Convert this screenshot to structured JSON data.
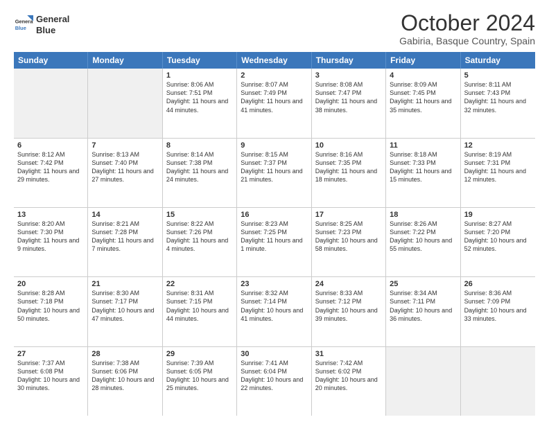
{
  "logo": {
    "line1": "General",
    "line2": "Blue"
  },
  "title": "October 2024",
  "location": "Gabiria, Basque Country, Spain",
  "header_days": [
    "Sunday",
    "Monday",
    "Tuesday",
    "Wednesday",
    "Thursday",
    "Friday",
    "Saturday"
  ],
  "weeks": [
    [
      {
        "day": "",
        "sunrise": "",
        "sunset": "",
        "daylight": "",
        "shaded": true
      },
      {
        "day": "",
        "sunrise": "",
        "sunset": "",
        "daylight": "",
        "shaded": true
      },
      {
        "day": "1",
        "sunrise": "Sunrise: 8:06 AM",
        "sunset": "Sunset: 7:51 PM",
        "daylight": "Daylight: 11 hours and 44 minutes."
      },
      {
        "day": "2",
        "sunrise": "Sunrise: 8:07 AM",
        "sunset": "Sunset: 7:49 PM",
        "daylight": "Daylight: 11 hours and 41 minutes."
      },
      {
        "day": "3",
        "sunrise": "Sunrise: 8:08 AM",
        "sunset": "Sunset: 7:47 PM",
        "daylight": "Daylight: 11 hours and 38 minutes."
      },
      {
        "day": "4",
        "sunrise": "Sunrise: 8:09 AM",
        "sunset": "Sunset: 7:45 PM",
        "daylight": "Daylight: 11 hours and 35 minutes."
      },
      {
        "day": "5",
        "sunrise": "Sunrise: 8:11 AM",
        "sunset": "Sunset: 7:43 PM",
        "daylight": "Daylight: 11 hours and 32 minutes."
      }
    ],
    [
      {
        "day": "6",
        "sunrise": "Sunrise: 8:12 AM",
        "sunset": "Sunset: 7:42 PM",
        "daylight": "Daylight: 11 hours and 29 minutes."
      },
      {
        "day": "7",
        "sunrise": "Sunrise: 8:13 AM",
        "sunset": "Sunset: 7:40 PM",
        "daylight": "Daylight: 11 hours and 27 minutes."
      },
      {
        "day": "8",
        "sunrise": "Sunrise: 8:14 AM",
        "sunset": "Sunset: 7:38 PM",
        "daylight": "Daylight: 11 hours and 24 minutes."
      },
      {
        "day": "9",
        "sunrise": "Sunrise: 8:15 AM",
        "sunset": "Sunset: 7:37 PM",
        "daylight": "Daylight: 11 hours and 21 minutes."
      },
      {
        "day": "10",
        "sunrise": "Sunrise: 8:16 AM",
        "sunset": "Sunset: 7:35 PM",
        "daylight": "Daylight: 11 hours and 18 minutes."
      },
      {
        "day": "11",
        "sunrise": "Sunrise: 8:18 AM",
        "sunset": "Sunset: 7:33 PM",
        "daylight": "Daylight: 11 hours and 15 minutes."
      },
      {
        "day": "12",
        "sunrise": "Sunrise: 8:19 AM",
        "sunset": "Sunset: 7:31 PM",
        "daylight": "Daylight: 11 hours and 12 minutes."
      }
    ],
    [
      {
        "day": "13",
        "sunrise": "Sunrise: 8:20 AM",
        "sunset": "Sunset: 7:30 PM",
        "daylight": "Daylight: 11 hours and 9 minutes."
      },
      {
        "day": "14",
        "sunrise": "Sunrise: 8:21 AM",
        "sunset": "Sunset: 7:28 PM",
        "daylight": "Daylight: 11 hours and 7 minutes."
      },
      {
        "day": "15",
        "sunrise": "Sunrise: 8:22 AM",
        "sunset": "Sunset: 7:26 PM",
        "daylight": "Daylight: 11 hours and 4 minutes."
      },
      {
        "day": "16",
        "sunrise": "Sunrise: 8:23 AM",
        "sunset": "Sunset: 7:25 PM",
        "daylight": "Daylight: 11 hours and 1 minute."
      },
      {
        "day": "17",
        "sunrise": "Sunrise: 8:25 AM",
        "sunset": "Sunset: 7:23 PM",
        "daylight": "Daylight: 10 hours and 58 minutes."
      },
      {
        "day": "18",
        "sunrise": "Sunrise: 8:26 AM",
        "sunset": "Sunset: 7:22 PM",
        "daylight": "Daylight: 10 hours and 55 minutes."
      },
      {
        "day": "19",
        "sunrise": "Sunrise: 8:27 AM",
        "sunset": "Sunset: 7:20 PM",
        "daylight": "Daylight: 10 hours and 52 minutes."
      }
    ],
    [
      {
        "day": "20",
        "sunrise": "Sunrise: 8:28 AM",
        "sunset": "Sunset: 7:18 PM",
        "daylight": "Daylight: 10 hours and 50 minutes."
      },
      {
        "day": "21",
        "sunrise": "Sunrise: 8:30 AM",
        "sunset": "Sunset: 7:17 PM",
        "daylight": "Daylight: 10 hours and 47 minutes."
      },
      {
        "day": "22",
        "sunrise": "Sunrise: 8:31 AM",
        "sunset": "Sunset: 7:15 PM",
        "daylight": "Daylight: 10 hours and 44 minutes."
      },
      {
        "day": "23",
        "sunrise": "Sunrise: 8:32 AM",
        "sunset": "Sunset: 7:14 PM",
        "daylight": "Daylight: 10 hours and 41 minutes."
      },
      {
        "day": "24",
        "sunrise": "Sunrise: 8:33 AM",
        "sunset": "Sunset: 7:12 PM",
        "daylight": "Daylight: 10 hours and 39 minutes."
      },
      {
        "day": "25",
        "sunrise": "Sunrise: 8:34 AM",
        "sunset": "Sunset: 7:11 PM",
        "daylight": "Daylight: 10 hours and 36 minutes."
      },
      {
        "day": "26",
        "sunrise": "Sunrise: 8:36 AM",
        "sunset": "Sunset: 7:09 PM",
        "daylight": "Daylight: 10 hours and 33 minutes."
      }
    ],
    [
      {
        "day": "27",
        "sunrise": "Sunrise: 7:37 AM",
        "sunset": "Sunset: 6:08 PM",
        "daylight": "Daylight: 10 hours and 30 minutes."
      },
      {
        "day": "28",
        "sunrise": "Sunrise: 7:38 AM",
        "sunset": "Sunset: 6:06 PM",
        "daylight": "Daylight: 10 hours and 28 minutes."
      },
      {
        "day": "29",
        "sunrise": "Sunrise: 7:39 AM",
        "sunset": "Sunset: 6:05 PM",
        "daylight": "Daylight: 10 hours and 25 minutes."
      },
      {
        "day": "30",
        "sunrise": "Sunrise: 7:41 AM",
        "sunset": "Sunset: 6:04 PM",
        "daylight": "Daylight: 10 hours and 22 minutes."
      },
      {
        "day": "31",
        "sunrise": "Sunrise: 7:42 AM",
        "sunset": "Sunset: 6:02 PM",
        "daylight": "Daylight: 10 hours and 20 minutes."
      },
      {
        "day": "",
        "sunrise": "",
        "sunset": "",
        "daylight": "",
        "shaded": true
      },
      {
        "day": "",
        "sunrise": "",
        "sunset": "",
        "daylight": "",
        "shaded": true
      }
    ]
  ]
}
